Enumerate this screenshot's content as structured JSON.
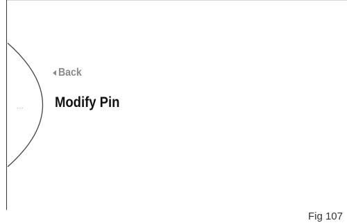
{
  "screen": {
    "back_label": "Back",
    "title": "Modify Pin",
    "ellipsis": "..."
  },
  "figure": {
    "caption": "Fig 107"
  },
  "icons": {
    "back": "back-arrow-icon"
  },
  "colors": {
    "back": "#8a8a8a",
    "title": "#111111",
    "dial": "#444444"
  }
}
